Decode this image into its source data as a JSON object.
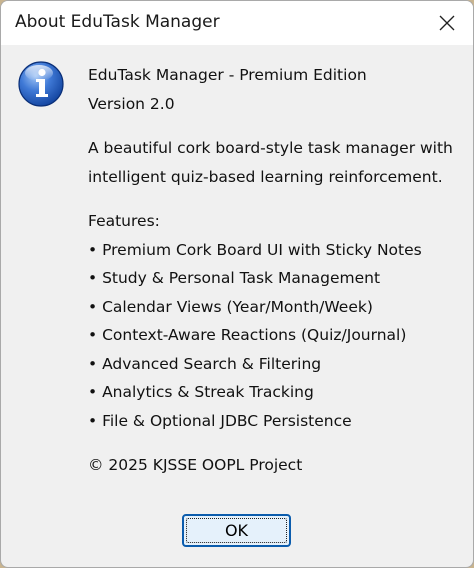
{
  "window": {
    "title": "About EduTask Manager",
    "close_icon": "close-icon"
  },
  "message": {
    "icon": "info-icon",
    "app_name_line": "EduTask Manager - Premium Edition",
    "version_line": "Version 2.0",
    "description_lines": [
      "A beautiful cork board-style task manager with",
      "intelligent quiz-based learning reinforcement."
    ],
    "features_heading": "Features:",
    "features": [
      "• Premium Cork Board UI with Sticky Notes",
      "• Study & Personal Task Management",
      "• Calendar Views (Year/Month/Week)",
      "• Context-Aware Reactions (Quiz/Journal)",
      "• Advanced Search & Filtering",
      "• Analytics & Streak Tracking",
      "• File & Optional JDBC Persistence"
    ],
    "copyright": "© 2025 KJSSE OOPL Project"
  },
  "buttons": {
    "ok_label": "OK"
  },
  "colors": {
    "accent_border": "#0b5cad",
    "ok_background": "#e5f1fb",
    "dialog_background": "#f0f0f0"
  }
}
